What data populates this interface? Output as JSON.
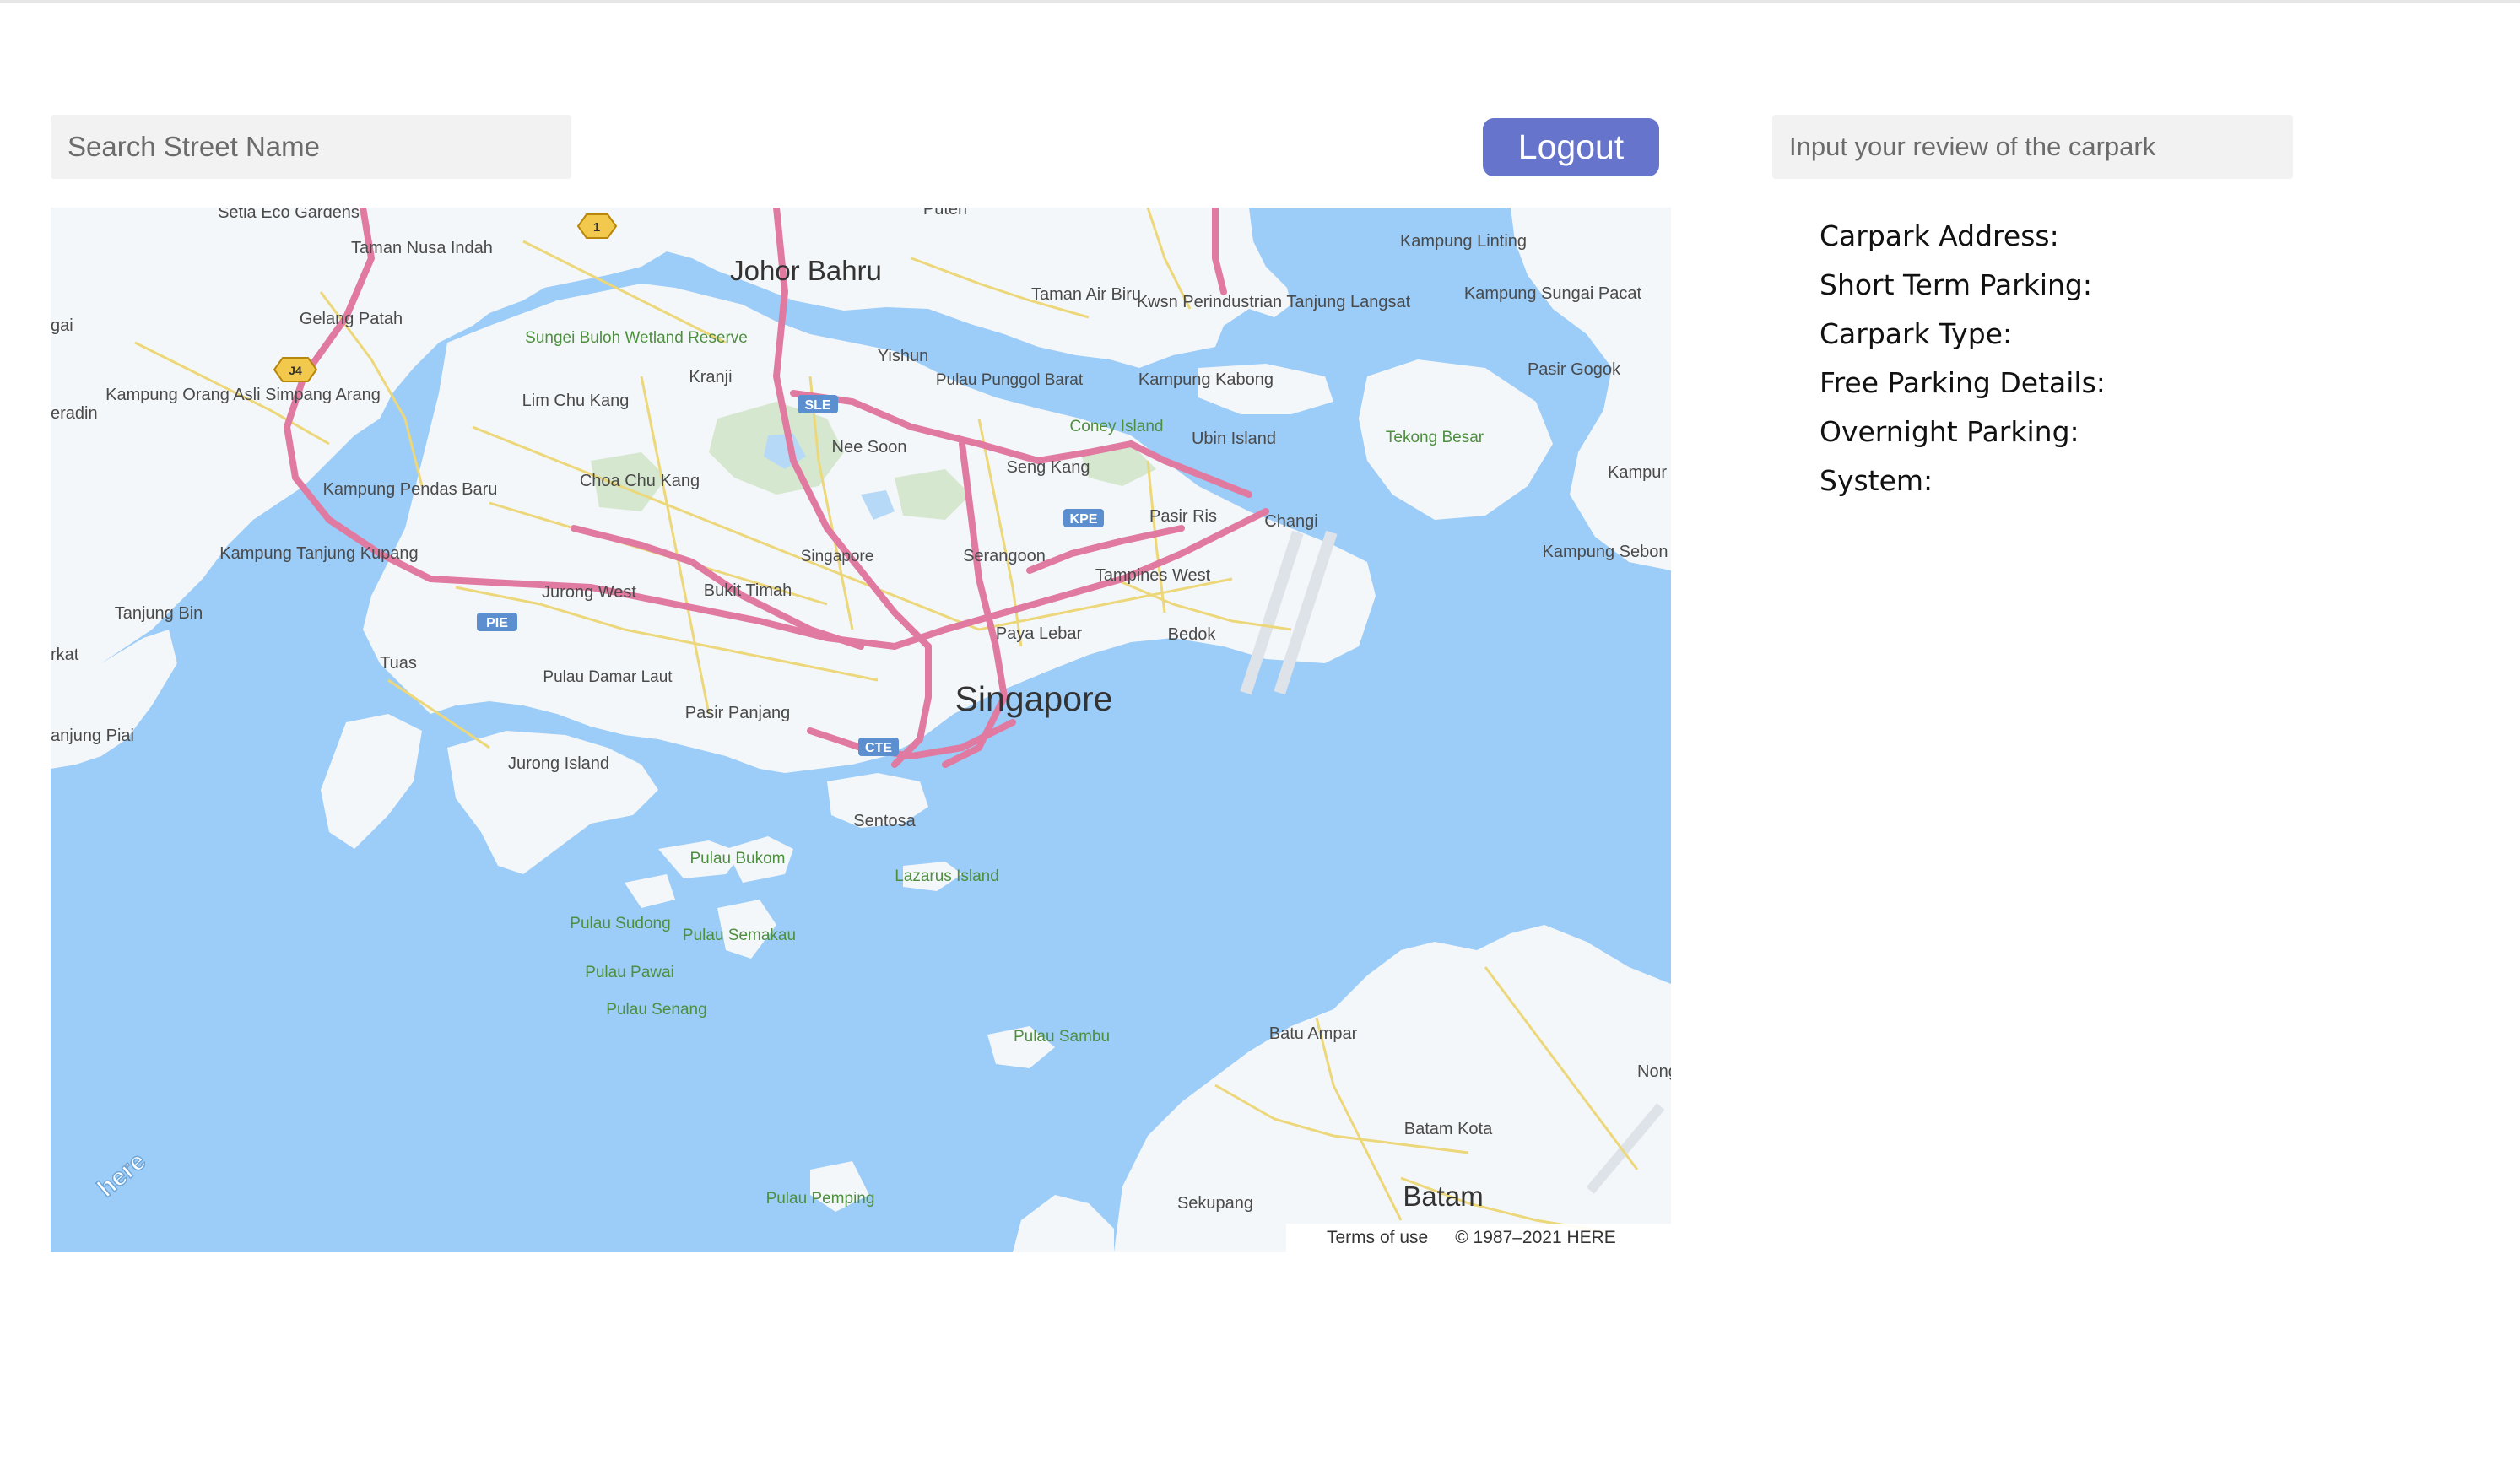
{
  "search": {
    "placeholder": "Search Street Name"
  },
  "logout": {
    "label": "Logout"
  },
  "review": {
    "placeholder": "Input your review of the carpark"
  },
  "details": {
    "carpark_address": "Carpark Address:",
    "short_term_parking": "Short Term Parking:",
    "carpark_type": "Carpark Type:",
    "free_parking_details": "Free Parking Details:",
    "overnight_parking": "Overnight Parking:",
    "system": "System:"
  },
  "map": {
    "places": {
      "johor_bahru": "Johor Bahru",
      "singapore_big": "Singapore",
      "batam": "Batam",
      "setia_eco_gardens": "Setia Eco Gardens",
      "taman_nusa_indah": "Taman Nusa Indah",
      "gelang_patah": "Gelang Patah",
      "kampung_orang_asli": "Kampung Orang Asli Simpang Arang",
      "sungei_buloh": "Sungei Buloh Wetland Reserve",
      "lim_chu_kang": "Lim Chu Kang",
      "kranji": "Kranji",
      "yishun": "Yishun",
      "pulau_punggol_barat": "Pulau Punggol Barat",
      "taman_air_biru": "Taman Air Biru",
      "kwsn": "Kwsn Perindustrian Tanjung Langsat",
      "kampung_linting": "Kampung Linting",
      "kampung_sungai_pacat": "Kampung Sungai Pacat",
      "pasir_gogok": "Pasir Gogok",
      "kampung_kabong": "Kampung Kabong",
      "coney_island": "Coney Island",
      "ubin_island": "Ubin Island",
      "tekong_besar": "Tekong Besar",
      "nee_soon": "Nee Soon",
      "seng_kang": "Seng Kang",
      "choa_chu_kang": "Choa Chu Kang",
      "kampung_pendas_baru": "Kampung Pendas Baru",
      "pasir_ris": "Pasir Ris",
      "changi": "Changi",
      "kampung_sebon": "Kampung Sebon",
      "kampung_tanjung_kupang": "Kampung Tanjung Kupang",
      "singapore_small": "Singapore",
      "serangoon": "Serangoon",
      "tampines_west": "Tampines West",
      "jurong_west": "Jurong West",
      "bukit_timah": "Bukit Timah",
      "tanjung_bin": "Tanjung Bin",
      "paya_lebar": "Paya Lebar",
      "bedok": "Bedok",
      "tuas": "Tuas",
      "pulau_damar_laut": "Pulau Damar Laut",
      "pasir_panjang": "Pasir Panjang",
      "jurong_island": "Jurong Island",
      "sentosa": "Sentosa",
      "pulau_bukom": "Pulau Bukom",
      "lazarus_island": "Lazarus Island",
      "pulau_sudong": "Pulau Sudong",
      "pulau_semakau": "Pulau Semakau",
      "pulau_pawai": "Pulau Pawai",
      "pulau_senang": "Pulau Senang",
      "pulau_sambu": "Pulau Sambu",
      "batu_ampar": "Batu Ampar",
      "nongsa": "Nongsa",
      "batam_kota": "Batam Kota",
      "sekupang": "Sekupang",
      "pulau_pemping": "Pulau Pemping",
      "puteri": "Puteri",
      "gai": "gai",
      "eradin": "eradin",
      "rkat": "rkat",
      "anjung_piai": "anjung Piai",
      "kampur": "Kampur"
    },
    "shields": {
      "sle": "SLE",
      "kpe": "KPE",
      "pie": "PIE",
      "cte": "CTE",
      "j4": "J4",
      "one": "1"
    },
    "terms": "Terms of use",
    "copyright": "© 1987–2021 HERE",
    "logo": "here",
    "colors": {
      "water": "#9cccf8",
      "land": "#f4f7f9",
      "park": "#d5e8cf",
      "highway": "#e07aa0",
      "road": "#ecd77a"
    }
  }
}
